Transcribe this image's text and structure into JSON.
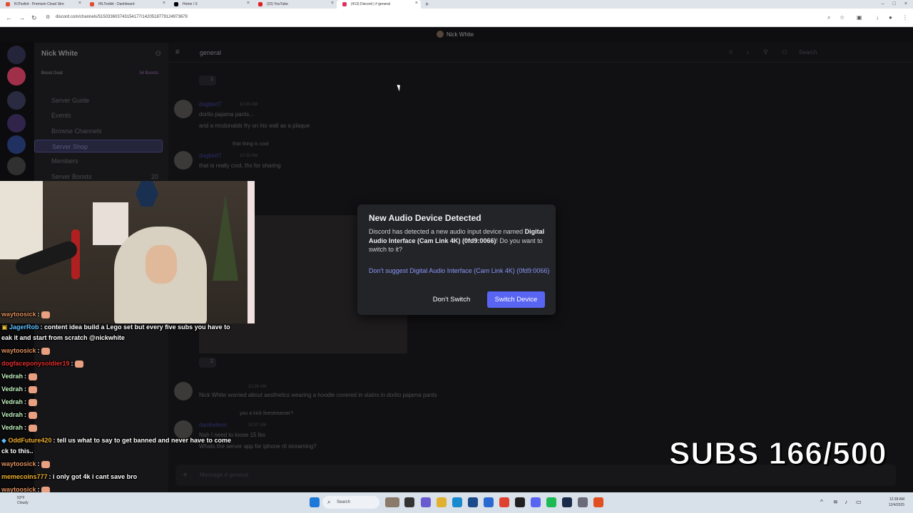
{
  "browser": {
    "tabs": [
      {
        "label": "RJToolkit - Premium Cloud Stre",
        "color": "#e05030"
      },
      {
        "label": "IRLToolkit - Dashboard",
        "color": "#e05030"
      },
      {
        "label": "Home / X",
        "color": "#000000"
      },
      {
        "label": "(32) YouTube",
        "color": "#e02020"
      },
      {
        "label": "(413) Discord | # general",
        "color": "#e03060"
      }
    ],
    "new_tab": "+",
    "url": "discord.com/channels/515033603743154177/1420518779124973679"
  },
  "discord": {
    "title": "Nick White",
    "server_name": "Nick White",
    "boost_goal": "Boost Goal",
    "boost_count": "34 Boosts",
    "channels": [
      {
        "label": "Server Guide"
      },
      {
        "label": "Events"
      },
      {
        "label": "Browse Channels"
      },
      {
        "label": "Server Shop"
      },
      {
        "label": "Members"
      },
      {
        "label": "Server Boosts",
        "count": "20"
      }
    ],
    "channel_name": "general",
    "search_placeholder": "Search",
    "messages": [
      {
        "name": "dogbert7",
        "time": "10:30 AM",
        "lines": [
          "dorito pajama pants...",
          "and a mcdonalds fry on his wall as a plaque"
        ]
      },
      {
        "reply": "that thing is cool",
        "name": "dogbert7",
        "time": "10:33 AM",
        "lines": [
          "that is really cool, thx for sharing"
        ]
      },
      {
        "name": "",
        "time": "10:34 AM",
        "lines": [
          "Nick White worried about aesthetics wearing a hoodie covered in stains in dorito pajama pants"
        ]
      },
      {
        "reply": "you a kick livestreamer?",
        "name": "daniheleon",
        "time": "10:37 AM",
        "lines": [
          "Nah I need to loose 15 lbs",
          "Whats the server app for iphone rtl streaming?"
        ]
      }
    ],
    "reaction_counts": [
      "1",
      "2"
    ],
    "composer_placeholder": "Message # general"
  },
  "modal": {
    "title": "New Audio Device Detected",
    "body_prefix": "Discord has detected a new audio input device named",
    "device_name": "Digital Audio Interface (Cam Link 4K) (0fd9:0066)",
    "body_suffix": "! Do you want to switch to it?",
    "link": "Don't suggest Digital Audio Interface (Cam Link 4K) (0fd9:0066) again",
    "cancel_label": "Don't Switch",
    "confirm_label": "Switch Device",
    "accent": "#5865f2"
  },
  "stream": {
    "subs_label": "SUBS 166/500",
    "chat": [
      {
        "user": "waytoosick",
        "color": "#e09060",
        "text": ""
      },
      {
        "user": "JagerRob",
        "color": "#60c0ff",
        "text": "content idea build a Lego set but every five subs you have to"
      },
      {
        "user": "",
        "color": "#ffffff",
        "text": "eak it and start from scratch @nickwhite"
      },
      {
        "user": "waytoosick",
        "color": "#e09060",
        "text": ""
      },
      {
        "user": "dogfaceponysoldier19",
        "color": "#e03030",
        "text": ""
      },
      {
        "user": "Vedrah",
        "color": "#c0f0c0",
        "text": ""
      },
      {
        "user": "Vedrah",
        "color": "#c0f0c0",
        "text": ""
      },
      {
        "user": "Vedrah",
        "color": "#c0f0c0",
        "text": ""
      },
      {
        "user": "Vedrah",
        "color": "#c0f0c0",
        "text": ""
      },
      {
        "user": "Vedrah",
        "color": "#c0f0c0",
        "text": ""
      },
      {
        "user": "OddFuture420",
        "color": "#f0b030",
        "text": "tell us what to say to get banned and never have to come"
      },
      {
        "user": "",
        "color": "#ffffff",
        "text": "ck to this.."
      },
      {
        "user": "waytoosick",
        "color": "#e09060",
        "text": ""
      },
      {
        "user": "memecoins777",
        "color": "#f0b030",
        "text": "i only got 4k i cant save bro"
      },
      {
        "user": "waytoosick",
        "color": "#e09060",
        "text": ""
      }
    ]
  },
  "taskbar": {
    "weather_temp": "53°F",
    "weather_text": "Cloudy",
    "search_label": "Search",
    "time": "12:38 AM",
    "date": "12/4/2025"
  }
}
